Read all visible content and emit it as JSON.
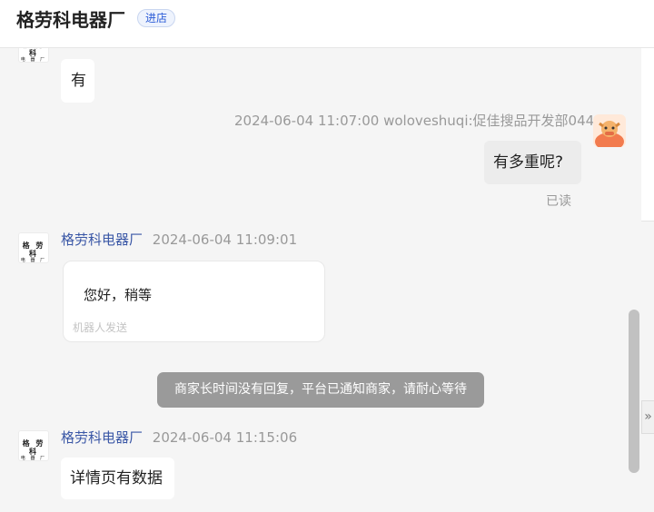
{
  "header": {
    "shop_name": "格劳科电器厂",
    "enter_store_label": "进店"
  },
  "avatar_shop": {
    "line1": "格 劳 科",
    "line2": "电 器 厂"
  },
  "messages": {
    "m1_text": "有",
    "m2_meta": "2024-06-04 11:07:00  woloveshuqi:促佳搜品开发部044",
    "m2_text": "有多重呢?",
    "m2_read": "已读",
    "m3_sender": "格劳科电器厂",
    "m3_time": "2024-06-04 11:09:01",
    "m3_text": "您好，稍等",
    "m3_tag": "机器人发送",
    "notice": "商家长时间没有回复，平台已通知商家，请耐心等待",
    "m4_sender": "格劳科电器厂",
    "m4_time": "2024-06-04 11:15:06",
    "m4_text": "详情页有数据"
  },
  "side_tab": {
    "icon": "double-chevron-right-icon",
    "glyph": "»"
  },
  "colors": {
    "accent": "#3a57a6",
    "badge": "#2a5bd7",
    "notice_bg": "#9a9a9a"
  }
}
